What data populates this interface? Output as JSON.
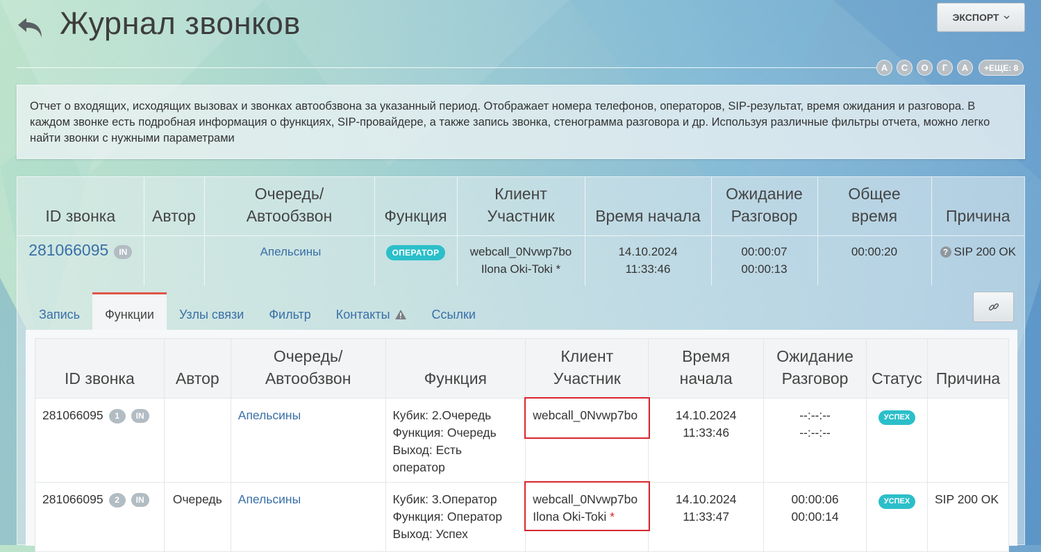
{
  "header": {
    "title": "Журнал звонков",
    "export_label": "ЭКСПОРТ",
    "avatars": [
      "А",
      "С",
      "О",
      "Г",
      "А"
    ],
    "more_label": "+ЕЩЕ: 8"
  },
  "description": "Отчет о входящих, исходящих вызовах и звонках автообзвона за указанный период. Отображает номера телефонов, операторов, SIP-результат, время ожидания и разговора. В каждом звонке есть подробная информация о функциях, SIP-провайдере, а также запись звонка, стенограмма разговора и др. Используя различные фильтры отчета, можно легко найти звонки с нужными параметрами",
  "main_table": {
    "headers": {
      "call_id": "ID звонка",
      "author": "Автор",
      "queue_1": "Очередь/",
      "queue_2": "Автообзвон",
      "function": "Функция",
      "client_1": "Клиент",
      "client_2": "Участник",
      "start": "Время начала",
      "wait_1": "Ожидание",
      "wait_2": "Разговор",
      "total_1": "Общее",
      "total_2": "время",
      "reason": "Причина"
    },
    "row": {
      "call_id": "281066095",
      "direction": "IN",
      "author": "",
      "queue": "Апельсины",
      "function": "ОПЕРАТОР",
      "client": "webcall_0Nvwp7bo",
      "participant": "Ilona Oki-Toki *",
      "start_date": "14.10.2024",
      "start_time": "11:33:46",
      "wait": "00:00:07",
      "talk": "00:00:13",
      "total": "00:00:20",
      "reason": "SIP 200 OK"
    }
  },
  "tabs": [
    {
      "label": "Запись"
    },
    {
      "label": "Функции"
    },
    {
      "label": "Узлы связи"
    },
    {
      "label": "Фильтр"
    },
    {
      "label": "Контакты"
    },
    {
      "label": "Ссылки"
    }
  ],
  "inner_table": {
    "headers": {
      "call_id": "ID звонка",
      "author": "Автор",
      "queue_1": "Очередь/",
      "queue_2": "Автообзвон",
      "function": "Функция",
      "client_1": "Клиент",
      "client_2": "Участник",
      "start_1": "Время",
      "start_2": "начала",
      "wait_1": "Ожидание",
      "wait_2": "Разговор",
      "status": "Статус",
      "reason": "Причина"
    },
    "rows": [
      {
        "call_id": "281066095",
        "step": "1",
        "direction": "IN",
        "author": "",
        "queue": "Апельсины",
        "func_1": "Кубик: 2.Очередь",
        "func_2": "Функция: Очередь",
        "func_3": "Выход: Есть",
        "func_4": "оператор",
        "client": "webcall_0Nvwp7bo",
        "participant": "",
        "start_date": "14.10.2024",
        "start_time": "11:33:46",
        "wait": "--:--:--",
        "talk": "--:--:--",
        "status": "УСПЕХ",
        "reason": ""
      },
      {
        "call_id": "281066095",
        "step": "2",
        "direction": "IN",
        "author": "Очередь",
        "queue": "Апельсины",
        "func_1": "Кубик: 3.Оператор",
        "func_2": "Функция: Оператор",
        "func_3": "Выход: Успех",
        "func_4": "",
        "client": "webcall_0Nvwp7bo",
        "participant": "Ilona Oki-Toki",
        "participant_mark": "*",
        "start_date": "14.10.2024",
        "start_time": "11:33:47",
        "wait": "00:00:06",
        "talk": "00:00:14",
        "status": "УСПЕХ",
        "reason": "SIP 200 OK"
      }
    ]
  },
  "colors": {
    "accent_teal": "#2bbfc9",
    "link_blue": "#3a6fa7",
    "highlight_red": "#d9262c",
    "active_tab_border": "#e0554a"
  }
}
